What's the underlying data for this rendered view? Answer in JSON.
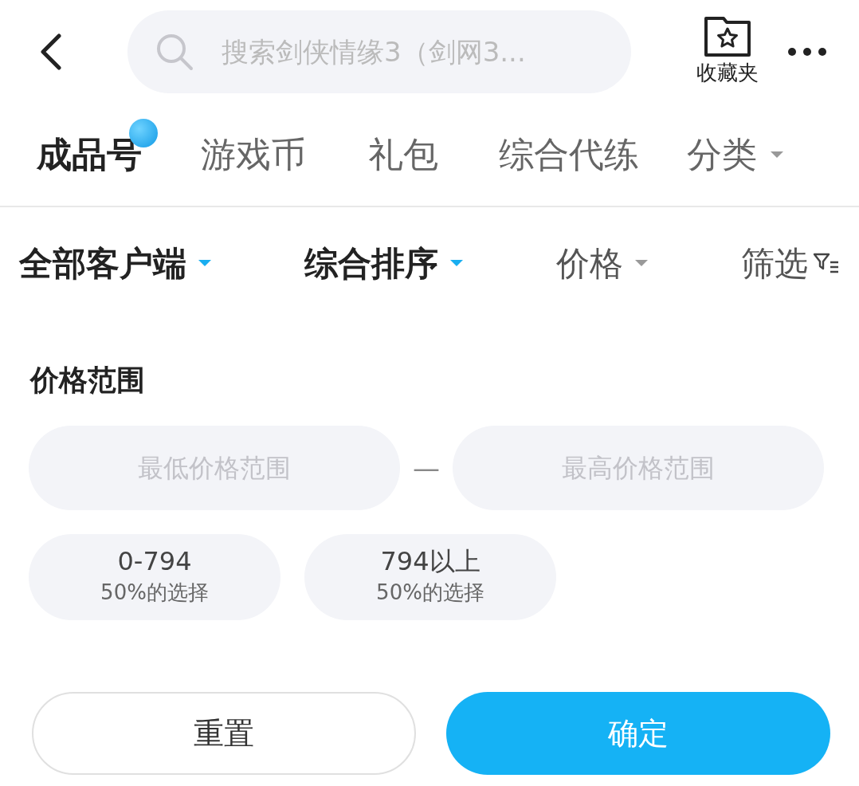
{
  "header": {
    "search": {
      "placeholder": "搜索剑侠情缘3（剑网3..."
    },
    "favorites": {
      "label": "收藏夹"
    }
  },
  "tabs": [
    {
      "label": "成品号",
      "selected": true,
      "badge": true,
      "kind": "tab"
    },
    {
      "label": "游戏币",
      "selected": false,
      "badge": false,
      "kind": "tab"
    },
    {
      "label": "礼包",
      "selected": false,
      "badge": false,
      "kind": "tab"
    },
    {
      "label": "综合代练",
      "selected": false,
      "badge": false,
      "kind": "tab"
    },
    {
      "label": "分类",
      "selected": false,
      "badge": false,
      "kind": "dropdown"
    }
  ],
  "filters": [
    {
      "label": "全部客户端",
      "active": true,
      "kind": "dropdown"
    },
    {
      "label": "综合排序",
      "active": true,
      "kind": "dropdown"
    },
    {
      "label": "价格",
      "active": false,
      "kind": "dropdown"
    },
    {
      "label": "筛选",
      "active": false,
      "kind": "filter"
    }
  ],
  "price_panel": {
    "title": "价格范围",
    "min": {
      "placeholder": "最低价格范围"
    },
    "separator": "—",
    "max": {
      "placeholder": "最高价格范围"
    },
    "presets": [
      {
        "range": "0-794",
        "share": "50%的选择",
        "selected": false
      },
      {
        "range": "794以上",
        "share": "50%的选择",
        "selected": false
      }
    ]
  },
  "buttons": [
    {
      "label": "重置",
      "kind": "secondary"
    },
    {
      "label": "确定",
      "kind": "primary"
    }
  ]
}
